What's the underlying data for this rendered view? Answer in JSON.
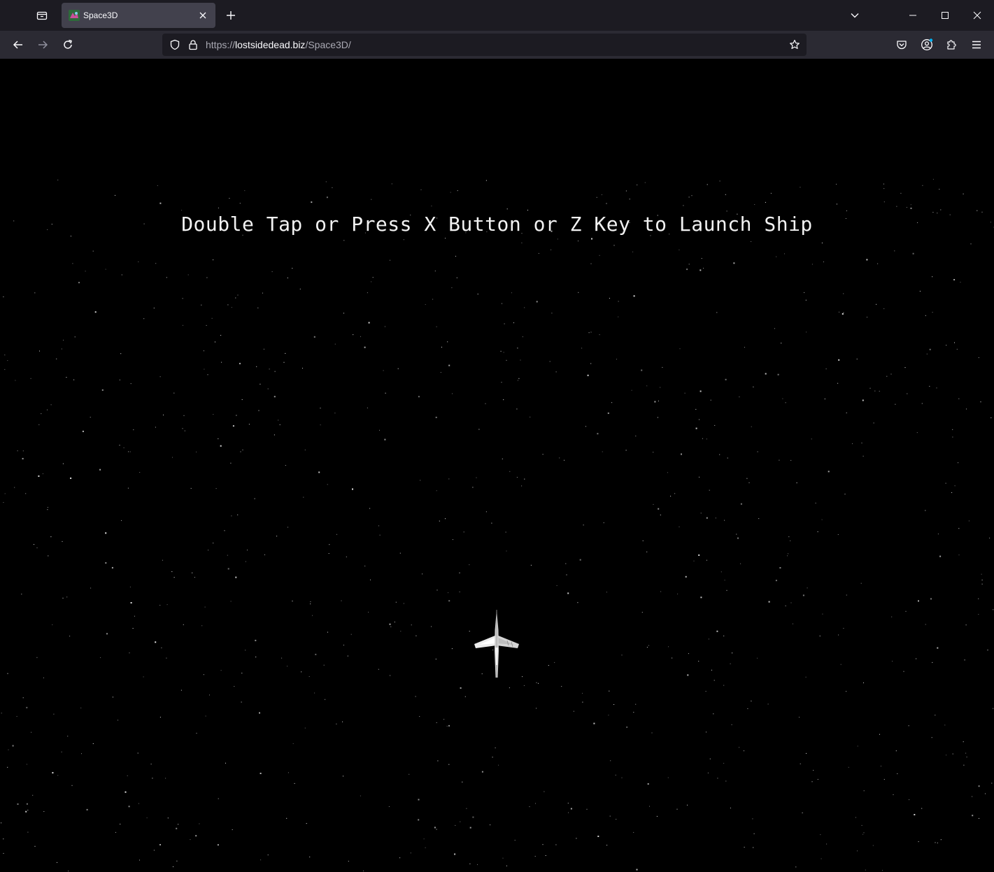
{
  "browser": {
    "tab": {
      "title": "Space3D"
    },
    "url": {
      "scheme": "https://",
      "host": "lostsidedead.biz",
      "path": "/Space3D/"
    }
  },
  "game": {
    "launch_message": "Double Tap or Press X Button or Z Key to Launch Ship",
    "background_color": "#000000",
    "star_color": "#ffffff"
  },
  "icons": {
    "tab_list": "tab-list-icon",
    "new_tab": "plus-icon",
    "list_all_tabs": "chevron-down-icon",
    "minimize": "minimize-icon",
    "maximize": "maximize-icon",
    "close_window": "close-icon",
    "back": "back-arrow-icon",
    "forward": "forward-arrow-icon",
    "reload": "reload-icon",
    "tracking_protection": "shield-icon",
    "site_security": "lock-icon",
    "bookmark": "star-icon",
    "pocket": "pocket-icon",
    "account": "account-icon",
    "extensions": "puzzle-icon",
    "menu": "hamburger-menu-icon"
  }
}
